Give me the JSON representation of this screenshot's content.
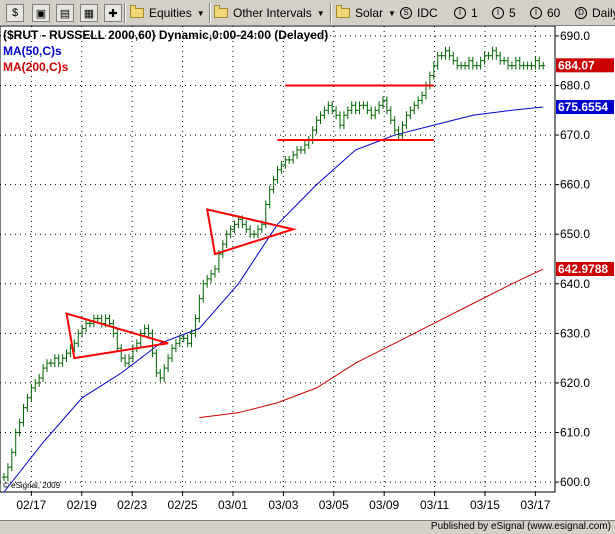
{
  "toolbar": {
    "equities_label": "Equities",
    "other_intervals_label": "Other Intervals",
    "symbol_label": "Solar",
    "idc_label": "IDC",
    "interval_1_label": "1",
    "interval_5_label": "5",
    "interval_60_label": "60",
    "daily_label": "Daily"
  },
  "footer": {
    "published_by": "Published by eSignal (www.esignal.com)"
  },
  "colors": {
    "price_bars": "#006400",
    "ma50": "#0000cc",
    "ma200": "#cc0000",
    "annotation": "#ff0000",
    "grid": "#000000"
  },
  "chart_data": {
    "type": "line",
    "title": "($RUT - RUSSELL 2000,60) Dynamic,0:00-24:00 (Delayed)",
    "watermark": "© eSignal, 2009",
    "ylim": [
      598,
      692
    ],
    "y_ticks": [
      600,
      610,
      620,
      630,
      640,
      650,
      660,
      670,
      680,
      690
    ],
    "x_ticks": [
      "02/17",
      "02/19",
      "02/23",
      "02/25",
      "03/01",
      "03/03",
      "03/05",
      "03/09",
      "03/11",
      "03/15",
      "03/17"
    ],
    "price_labels": [
      {
        "label": "684.07",
        "value": 684.07,
        "color": "#cc0000"
      },
      {
        "label": "675.6554",
        "value": 675.6554,
        "color": "#0000cc"
      },
      {
        "label": "642.9788",
        "value": 642.9788,
        "color": "#cc0000"
      }
    ],
    "series": [
      {
        "name": "$RUT",
        "x": [
          0,
          1,
          2,
          3,
          4,
          5,
          6,
          7,
          8,
          9,
          10,
          11,
          12,
          13,
          14,
          15,
          16,
          17,
          18,
          19,
          20,
          21,
          22,
          23,
          24,
          25,
          26,
          27,
          28,
          29,
          30,
          31,
          32,
          33,
          34,
          35,
          36,
          37,
          38,
          39,
          40,
          41,
          42,
          43,
          44,
          45,
          46,
          47,
          48,
          49,
          50,
          51,
          52,
          53,
          54,
          55,
          56,
          57,
          58,
          59,
          60,
          61,
          62,
          63,
          64,
          65,
          66,
          67,
          68,
          69,
          70,
          71,
          72,
          73,
          74,
          75,
          76,
          77,
          78,
          79,
          80,
          81,
          82,
          83,
          84,
          85,
          86,
          87,
          88,
          89,
          90,
          91,
          92,
          93,
          94,
          95,
          96,
          97,
          98,
          99,
          100,
          101,
          102,
          103,
          104,
          105,
          106,
          107,
          108,
          109,
          110,
          111,
          112,
          113,
          114,
          115,
          116,
          117,
          118,
          119,
          120,
          121,
          122,
          123,
          124,
          125,
          126,
          127,
          128,
          129,
          130,
          131,
          132,
          133,
          134,
          135,
          136,
          137,
          138
        ],
        "values": [
          601,
          603,
          606,
          610,
          612,
          615,
          617,
          619,
          620,
          621,
          623,
          624,
          624,
          625,
          624,
          625,
          626,
          627,
          628,
          630,
          631,
          632,
          632,
          633,
          633,
          632,
          633,
          632,
          630,
          627,
          625,
          624,
          625,
          627,
          628,
          630,
          631,
          630,
          626,
          622,
          621,
          623,
          625,
          627,
          628,
          629,
          629,
          628,
          630,
          633,
          637,
          640,
          641,
          642,
          643,
          646,
          648,
          650,
          651,
          652,
          653,
          652,
          651,
          650,
          650,
          651,
          652,
          656,
          659,
          661,
          663,
          664,
          665,
          665,
          666,
          667,
          667,
          668,
          669,
          671,
          673,
          674,
          675,
          676,
          675,
          674,
          672,
          674,
          675,
          676,
          675,
          676,
          676,
          675,
          674,
          675,
          676,
          677,
          675,
          673,
          671,
          670,
          672,
          674,
          675,
          676,
          677,
          678,
          680,
          682,
          684,
          686,
          686,
          687,
          686,
          685,
          684,
          684,
          684,
          685,
          684,
          684,
          685,
          686,
          686,
          687,
          686,
          685,
          685,
          684,
          684,
          685,
          684,
          684,
          684,
          684,
          685,
          684,
          684
        ]
      },
      {
        "name": "MA(50,C)s",
        "x": [
          0,
          10,
          20,
          30,
          40,
          50,
          60,
          70,
          80,
          90,
          100,
          110,
          120,
          130,
          138
        ],
        "values": [
          598,
          608,
          617,
          622,
          628,
          631,
          640,
          652,
          660,
          667,
          670,
          672,
          674,
          675,
          675.6554
        ]
      },
      {
        "name": "MA(200,C)s",
        "x": [
          50,
          60,
          70,
          80,
          90,
          100,
          110,
          120,
          130,
          138
        ],
        "values": [
          613,
          614,
          616,
          619,
          624,
          628,
          632,
          636,
          640,
          642.9788
        ]
      }
    ],
    "annotations": [
      {
        "shape": "triangle",
        "points": [
          [
            16,
            634
          ],
          [
            42,
            628
          ],
          [
            18,
            625
          ]
        ]
      },
      {
        "shape": "triangle",
        "points": [
          [
            52,
            655
          ],
          [
            74,
            651
          ],
          [
            54,
            646
          ]
        ]
      },
      {
        "shape": "hline",
        "x": [
          72,
          110
        ],
        "value": 680
      },
      {
        "shape": "hline",
        "x": [
          70,
          110
        ],
        "value": 669
      }
    ]
  }
}
